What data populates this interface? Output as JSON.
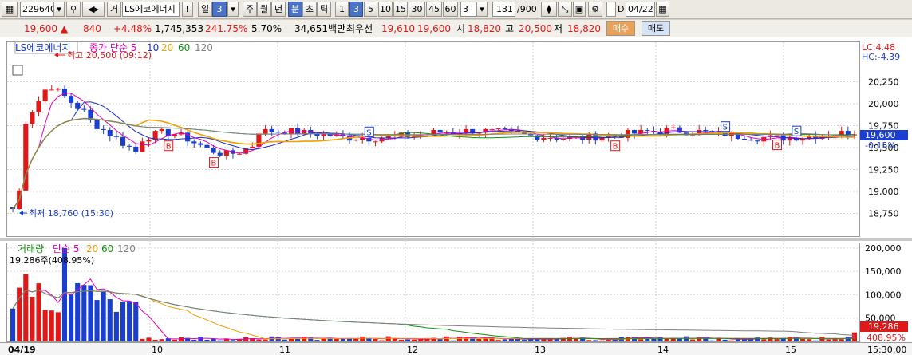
{
  "toolbar": {
    "code": "229640",
    "search_icon": "magnifier-icon",
    "sound_icon": "speaker-icon",
    "type_label": "거",
    "stock_name": "LS에코에너지",
    "alert_label": "!",
    "period_day": "일",
    "period_day_num": "3",
    "period_week": "주",
    "period_month": "월",
    "period_year": "년",
    "period_minute": "분",
    "period_second": "초",
    "period_tick": "틱",
    "intervals": [
      "1",
      "3",
      "5",
      "10",
      "15",
      "30",
      "45",
      "60"
    ],
    "interval_value": "3",
    "bar_count": "131",
    "bar_total": "/900",
    "date_label": "D",
    "date_value": "04/22"
  },
  "quote": {
    "price": "19,600",
    "change": "840",
    "change_pct": "+4.48%",
    "volume": "1,745,353",
    "vol_ratio": "241.75%",
    "turnover_pct": "5.70%",
    "amount": "34,651백만",
    "best_bid_label": "최우선",
    "best_ask": "19,610",
    "best_bid": "19,600",
    "open_label": "시",
    "open": "18,820",
    "high_label": "고",
    "high": "20,500",
    "low_label": "저",
    "low": "18,820",
    "buy_button": "매수",
    "sell_button": "매도"
  },
  "price_panel": {
    "legend_name": "LS에코에너지",
    "legend_close": "종가",
    "legend_ma_type": "단순",
    "ma_periods": [
      "5",
      "10",
      "20",
      "60",
      "120"
    ],
    "ma_colors": [
      "#e000c0",
      "#1a2fc8",
      "#f0a000",
      "#109010",
      "#808080"
    ],
    "high_annot": "최고 20,500 (09:12)",
    "low_annot": "최저 18,760 (15:30)",
    "lc": "LC:4.48",
    "hc": "HC:-4.39",
    "current_price_tag": "19,600",
    "current_pct_tag": "-0.15%",
    "y_ticks": [
      "20,250",
      "20,000",
      "19,750",
      "19,500",
      "19,250",
      "19,000",
      "18,750"
    ],
    "buy_marker": "B",
    "sell_marker": "S"
  },
  "volume_panel": {
    "legend_name": "거래량",
    "legend_ma_type": "단순",
    "ma_periods": [
      "5",
      "20",
      "60",
      "120"
    ],
    "current_volume": "19,286주(408.95%)",
    "y_ticks": [
      "200,000",
      "150,000",
      "100,000",
      "50,000"
    ],
    "current_tag": "19,286",
    "current_pct_tag": "408.95%"
  },
  "x_axis": {
    "labels": [
      "04/19",
      "10",
      "11",
      "12",
      "13",
      "14",
      "15"
    ],
    "last_time": "15:30:00"
  },
  "colors": {
    "up": "#e01818",
    "down": "#1a3fd0",
    "selected": "#4a73c8"
  }
}
